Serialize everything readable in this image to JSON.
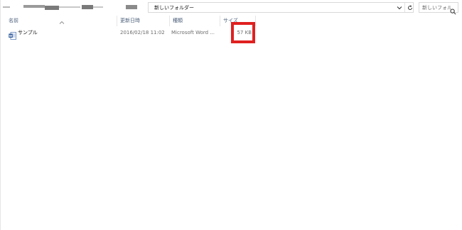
{
  "address_bar": {
    "path_label": "新しいフォルダー"
  },
  "search": {
    "placeholder": "新しいフォル..."
  },
  "icons": {
    "chevron": "chevron-down-icon",
    "refresh": "refresh-icon",
    "search": "search-icon",
    "sort": "sort-ascending-icon",
    "file": "word-document-icon"
  },
  "columns": {
    "name": "名前",
    "date": "更新日時",
    "type": "種類",
    "size": "サイズ"
  },
  "files": [
    {
      "name": "サンプル",
      "date": "2016/02/18 11:02",
      "type": "Microsoft Word ...",
      "size": "57 KB"
    }
  ],
  "colors": {
    "highlight": "#e02020",
    "header_text": "#4c607a"
  }
}
